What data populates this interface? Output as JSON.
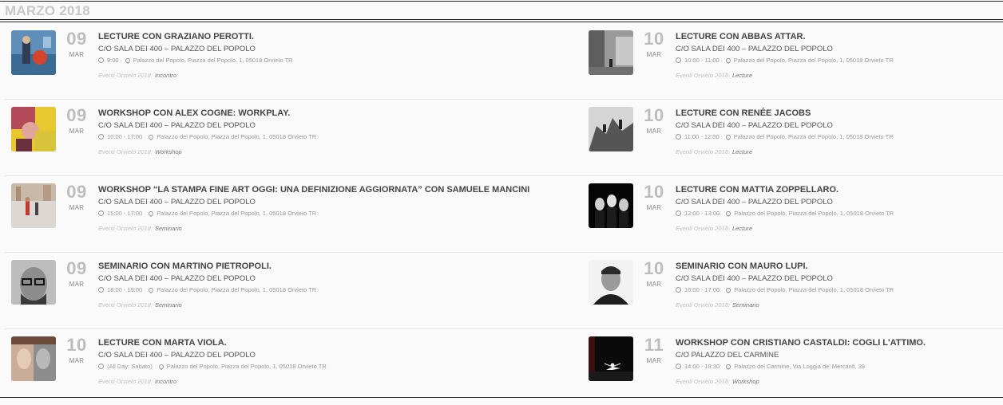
{
  "month_header": "MARZO 2018",
  "category_label": "Eventi Orvieto 2018:",
  "left_events": [
    {
      "day": "09",
      "month": "MAR",
      "title": "LECTURE CON GRAZIANO PEROTTI.",
      "venue": "C/O SALA DEI 400 – PALAZZO DEL POPOLO",
      "time": "9:00",
      "address": "Palazzo del Popolo, Piazza del Popolo, 1, 05018 Orvieto TR",
      "category": "Incontro",
      "thumb": "photo-blue-figure"
    },
    {
      "day": "09",
      "month": "MAR",
      "title": "WORKSHOP CON ALEX COGNE: WORKPLAY.",
      "venue": "C/O SALA DEI 400 – PALAZZO DEL POPOLO",
      "time": "10:00 - 17:00",
      "address": "Palazzo del Popolo, Piazza del Popolo, 1, 05018 Orvieto TR",
      "category": "Workshop",
      "thumb": "photo-colorful"
    },
    {
      "day": "09",
      "month": "MAR",
      "title": "WORKSHOP “LA STAMPA FINE ART OGGI: UNA DEFINIZIONE AGGIORNATA” CON SAMUELE MANCINI",
      "venue": "C/O SALA DEI 400 – PALAZZO DEL POPOLO",
      "time": "15:00 - 17:00",
      "address": "Palazzo del Popolo, Piazza del Popolo, 1, 05018 Orvieto TR",
      "category": "Seminario",
      "thumb": "photo-street"
    },
    {
      "day": "09",
      "month": "MAR",
      "title": "SEMINARIO CON MARTINO PIETROPOLI.",
      "venue": "C/O SALA DEI 400 – PALAZZO DEL POPOLO",
      "time": "18:00 - 19:00",
      "address": "Palazzo del Popolo, Piazza del Popolo, 1, 05018 Orvieto TR",
      "category": "Seminario",
      "thumb": "photo-portrait-glasses"
    },
    {
      "day": "10",
      "month": "MAR",
      "title": "LECTURE CON MARTA VIOLA.",
      "venue": "C/O SALA DEI 400 – PALAZZO DEL POPOLO",
      "time": "(All Day: Sabato)",
      "address": "Palazzo del Popolo, Piazza del Popolo, 1, 05018 Orvieto TR",
      "category": "Incontro",
      "thumb": "photo-faces"
    }
  ],
  "right_events": [
    {
      "day": "10",
      "month": "MAR",
      "title": "LECTURE CON ABBAS ATTAR.",
      "venue": "C/O SALA DEI 400 – PALAZZO DEL POPOLO",
      "time": "10:00 - 11:00",
      "address": "Palazzo del Popolo, Piazza del Popolo, 1, 05018 Orvieto TR",
      "category": "Lecture",
      "thumb": "photo-bw-street"
    },
    {
      "day": "10",
      "month": "MAR",
      "title": "LECTURE CON RENÉE JACOBS",
      "venue": "C/O SALA DEI 400 – PALAZZO DEL POPOLO",
      "time": "11:00 - 12:00",
      "address": "Palazzo del Popolo, Piazza del Popolo, 1, 05018 Orvieto TR",
      "category": "Lecture",
      "thumb": "photo-bw-rocks"
    },
    {
      "day": "10",
      "month": "MAR",
      "title": "LECTURE CON MATTIA ZOPPELLARO.",
      "venue": "C/O SALA DEI 400 – PALAZZO DEL POPOLO",
      "time": "12:00 - 13:00",
      "address": "Palazzo del Popolo, Piazza del Popolo, 1, 05018 Orvieto TR",
      "category": "Lecture",
      "thumb": "photo-band"
    },
    {
      "day": "10",
      "month": "MAR",
      "title": "SEMINARIO CON MAURO LUPI.",
      "venue": "C/O SALA DEI 400 – PALAZZO DEL POPOLO",
      "time": "16:00 - 17:00",
      "address": "Palazzo del Popolo, Piazza del Popolo, 1, 05018 Orvieto TR",
      "category": "Seminario",
      "thumb": "photo-portrait-smile"
    },
    {
      "day": "11",
      "month": "MAR",
      "title": "WORKSHOP CON CRISTIANO CASTALDI: COGLI L'ATTIMO.",
      "venue": "C/O PALAZZO DEL CARMINE",
      "time": "14:00 - 18:30",
      "address": "Palazzo del Carmine, Via Loggia de' Mercanti, 39",
      "category": "Workshop",
      "thumb": "photo-dancer"
    }
  ]
}
